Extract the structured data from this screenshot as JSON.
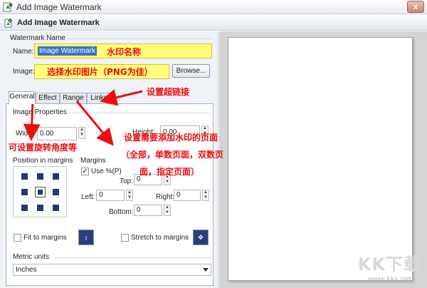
{
  "window": {
    "title": "Add Image Watermark",
    "close_label": "x"
  },
  "header": {
    "title": "Add Image Watermark"
  },
  "watermark_name": {
    "group_label": "Watermark Name",
    "name_label": "Name:",
    "name_value": "Image Watermark",
    "image_label": "Image:",
    "browse_label": "Browse..."
  },
  "tabs": [
    {
      "label": "General"
    },
    {
      "label": "Effect"
    },
    {
      "label": "Range"
    },
    {
      "label": "Links"
    }
  ],
  "image_properties": {
    "group_label": "Image Properties",
    "width_label": "Width",
    "width_value": "0.00",
    "height_label": "Height:",
    "height_value": "0.00"
  },
  "position": {
    "label": "Position in margins"
  },
  "margins": {
    "label": "Margins",
    "use_percent_label": "Use %(P)",
    "top_label": "Top:",
    "top_value": "0",
    "left_label": "Left:",
    "left_value": "0",
    "right_label": "Right:",
    "right_value": "0",
    "bottom_label": "Bottom:",
    "bottom_value": "0"
  },
  "fit_to_margins_label": "Fit to margins",
  "stretch_to_margins_label": "Stretch to margins",
  "metric": {
    "label": "Metric units",
    "value": "Inches"
  },
  "annotations": {
    "name_note": "水印名称",
    "image_note": "选择水印图片（PNG为佳）",
    "link_note": "设置超链接",
    "rotate_note": "可设置旋转角度等",
    "range_note_1": "设置需要添加水印的页面",
    "range_note_2": "（全部，单数页面，双数页",
    "range_note_3": "面，指定页面）"
  },
  "site_watermark": {
    "logo": "KK下载",
    "url": "www.kkx.net"
  },
  "colors": {
    "annotation": "#ef0d0d",
    "highlight": "#fffd7b",
    "selection": "#3a72c2",
    "grid_cell": "#24386f"
  }
}
